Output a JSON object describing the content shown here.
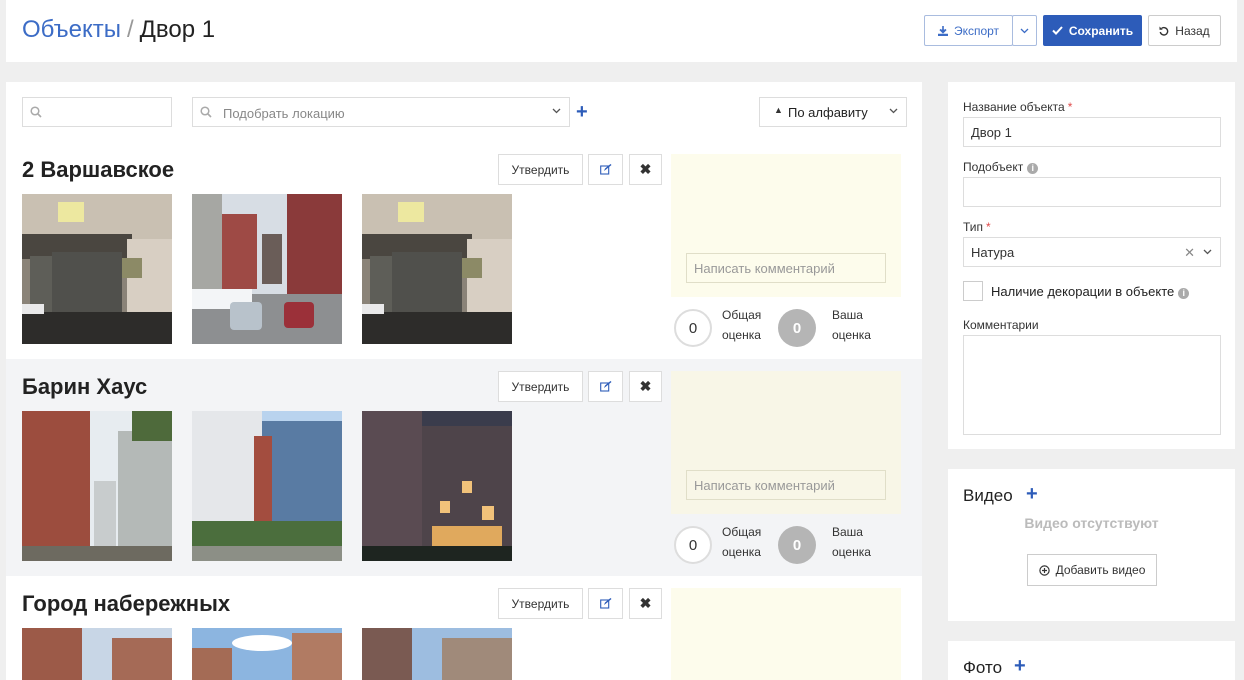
{
  "header": {
    "breadcrumb_root": "Объекты",
    "breadcrumb_sep": "/",
    "breadcrumb_current": "Двор 1",
    "export_label": "Экспорт",
    "save_label": "Сохранить",
    "back_label": "Назад"
  },
  "toolbar": {
    "search_placeholder": "",
    "location_placeholder": "Подобрать локацию",
    "sort_label": "По алфавиту"
  },
  "locations": [
    {
      "title": "2 Варшавское",
      "approve_label": "Утвердить",
      "comment_placeholder": "Написать комментарий",
      "total_score": "0",
      "total_label_1": "Общая",
      "total_label_2": "оценка",
      "your_score": "0",
      "your_label_1": "Ваша",
      "your_label_2": "оценка"
    },
    {
      "title": "Барин Хаус",
      "approve_label": "Утвердить",
      "comment_placeholder": "Написать комментарий",
      "total_score": "0",
      "total_label_1": "Общая",
      "total_label_2": "оценка",
      "your_score": "0",
      "your_label_1": "Ваша",
      "your_label_2": "оценка"
    },
    {
      "title": "Город набережных",
      "approve_label": "Утвердить"
    }
  ],
  "sidebar": {
    "name_label": "Название объекта",
    "name_value": "Двор 1",
    "subobject_label": "Подобъект",
    "subobject_value": "",
    "type_label": "Тип",
    "type_value": "Натура",
    "decoration_label": "Наличие декорации в объекте",
    "comments_label": "Комментарии",
    "video_title": "Видео",
    "video_empty": "Видео отсутствуют",
    "add_video_label": "Добавить видео",
    "photo_title": "Фото"
  },
  "colors": {
    "accent": "#2d5cb9",
    "link": "#3c6cc6",
    "comment_bg": "#fdfcec"
  }
}
